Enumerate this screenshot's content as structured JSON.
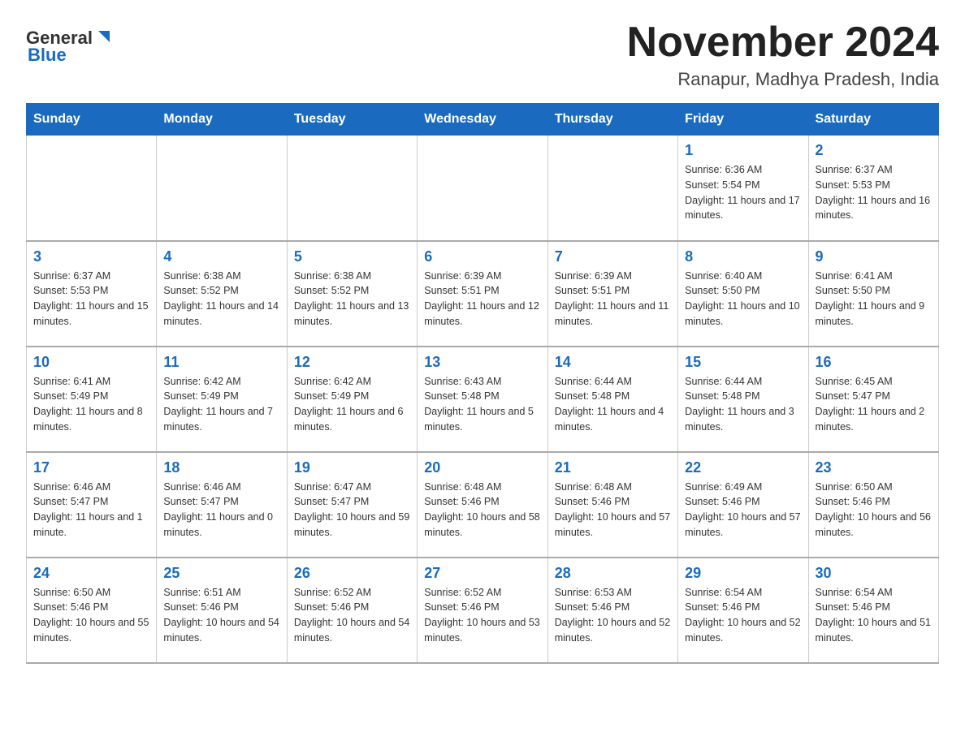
{
  "header": {
    "logo_general": "General",
    "logo_blue": "Blue",
    "month_title": "November 2024",
    "location": "Ranapur, Madhya Pradesh, India"
  },
  "days_of_week": [
    "Sunday",
    "Monday",
    "Tuesday",
    "Wednesday",
    "Thursday",
    "Friday",
    "Saturday"
  ],
  "weeks": [
    [
      {
        "day": "",
        "info": ""
      },
      {
        "day": "",
        "info": ""
      },
      {
        "day": "",
        "info": ""
      },
      {
        "day": "",
        "info": ""
      },
      {
        "day": "",
        "info": ""
      },
      {
        "day": "1",
        "info": "Sunrise: 6:36 AM\nSunset: 5:54 PM\nDaylight: 11 hours and 17 minutes."
      },
      {
        "day": "2",
        "info": "Sunrise: 6:37 AM\nSunset: 5:53 PM\nDaylight: 11 hours and 16 minutes."
      }
    ],
    [
      {
        "day": "3",
        "info": "Sunrise: 6:37 AM\nSunset: 5:53 PM\nDaylight: 11 hours and 15 minutes."
      },
      {
        "day": "4",
        "info": "Sunrise: 6:38 AM\nSunset: 5:52 PM\nDaylight: 11 hours and 14 minutes."
      },
      {
        "day": "5",
        "info": "Sunrise: 6:38 AM\nSunset: 5:52 PM\nDaylight: 11 hours and 13 minutes."
      },
      {
        "day": "6",
        "info": "Sunrise: 6:39 AM\nSunset: 5:51 PM\nDaylight: 11 hours and 12 minutes."
      },
      {
        "day": "7",
        "info": "Sunrise: 6:39 AM\nSunset: 5:51 PM\nDaylight: 11 hours and 11 minutes."
      },
      {
        "day": "8",
        "info": "Sunrise: 6:40 AM\nSunset: 5:50 PM\nDaylight: 11 hours and 10 minutes."
      },
      {
        "day": "9",
        "info": "Sunrise: 6:41 AM\nSunset: 5:50 PM\nDaylight: 11 hours and 9 minutes."
      }
    ],
    [
      {
        "day": "10",
        "info": "Sunrise: 6:41 AM\nSunset: 5:49 PM\nDaylight: 11 hours and 8 minutes."
      },
      {
        "day": "11",
        "info": "Sunrise: 6:42 AM\nSunset: 5:49 PM\nDaylight: 11 hours and 7 minutes."
      },
      {
        "day": "12",
        "info": "Sunrise: 6:42 AM\nSunset: 5:49 PM\nDaylight: 11 hours and 6 minutes."
      },
      {
        "day": "13",
        "info": "Sunrise: 6:43 AM\nSunset: 5:48 PM\nDaylight: 11 hours and 5 minutes."
      },
      {
        "day": "14",
        "info": "Sunrise: 6:44 AM\nSunset: 5:48 PM\nDaylight: 11 hours and 4 minutes."
      },
      {
        "day": "15",
        "info": "Sunrise: 6:44 AM\nSunset: 5:48 PM\nDaylight: 11 hours and 3 minutes."
      },
      {
        "day": "16",
        "info": "Sunrise: 6:45 AM\nSunset: 5:47 PM\nDaylight: 11 hours and 2 minutes."
      }
    ],
    [
      {
        "day": "17",
        "info": "Sunrise: 6:46 AM\nSunset: 5:47 PM\nDaylight: 11 hours and 1 minute."
      },
      {
        "day": "18",
        "info": "Sunrise: 6:46 AM\nSunset: 5:47 PM\nDaylight: 11 hours and 0 minutes."
      },
      {
        "day": "19",
        "info": "Sunrise: 6:47 AM\nSunset: 5:47 PM\nDaylight: 10 hours and 59 minutes."
      },
      {
        "day": "20",
        "info": "Sunrise: 6:48 AM\nSunset: 5:46 PM\nDaylight: 10 hours and 58 minutes."
      },
      {
        "day": "21",
        "info": "Sunrise: 6:48 AM\nSunset: 5:46 PM\nDaylight: 10 hours and 57 minutes."
      },
      {
        "day": "22",
        "info": "Sunrise: 6:49 AM\nSunset: 5:46 PM\nDaylight: 10 hours and 57 minutes."
      },
      {
        "day": "23",
        "info": "Sunrise: 6:50 AM\nSunset: 5:46 PM\nDaylight: 10 hours and 56 minutes."
      }
    ],
    [
      {
        "day": "24",
        "info": "Sunrise: 6:50 AM\nSunset: 5:46 PM\nDaylight: 10 hours and 55 minutes."
      },
      {
        "day": "25",
        "info": "Sunrise: 6:51 AM\nSunset: 5:46 PM\nDaylight: 10 hours and 54 minutes."
      },
      {
        "day": "26",
        "info": "Sunrise: 6:52 AM\nSunset: 5:46 PM\nDaylight: 10 hours and 54 minutes."
      },
      {
        "day": "27",
        "info": "Sunrise: 6:52 AM\nSunset: 5:46 PM\nDaylight: 10 hours and 53 minutes."
      },
      {
        "day": "28",
        "info": "Sunrise: 6:53 AM\nSunset: 5:46 PM\nDaylight: 10 hours and 52 minutes."
      },
      {
        "day": "29",
        "info": "Sunrise: 6:54 AM\nSunset: 5:46 PM\nDaylight: 10 hours and 52 minutes."
      },
      {
        "day": "30",
        "info": "Sunrise: 6:54 AM\nSunset: 5:46 PM\nDaylight: 10 hours and 51 minutes."
      }
    ]
  ]
}
